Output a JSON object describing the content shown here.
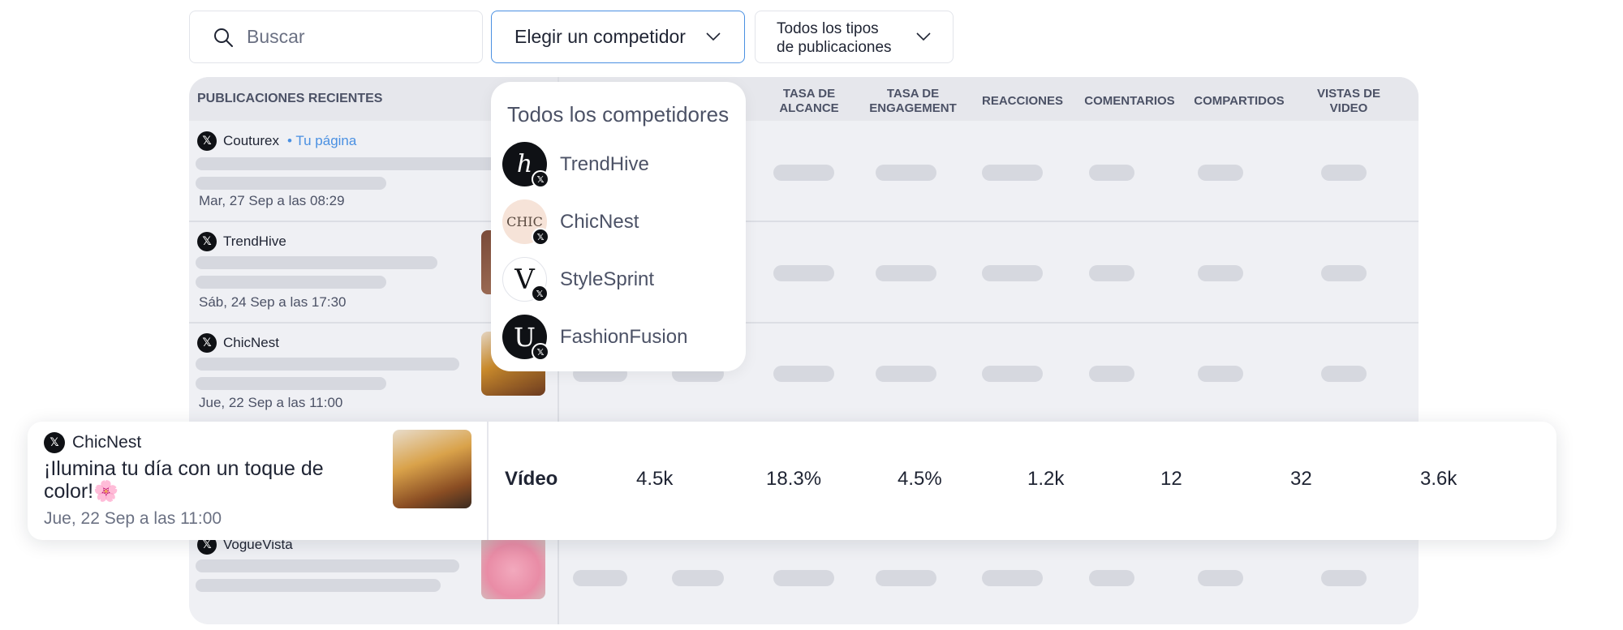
{
  "search": {
    "placeholder": "Buscar"
  },
  "competitor_dropdown": {
    "label": "Elegir un competidor"
  },
  "type_dropdown": {
    "label_line1": "Todos los tipos",
    "label_line2": "de publicaciones"
  },
  "table": {
    "headers": {
      "posts": "PUBLICACIONES RECIENTES",
      "reach_rate": [
        "TASA DE",
        "ALCANCE"
      ],
      "engagement_rate": [
        "TASA DE",
        "ENGAGEMENT"
      ],
      "reactions": "REACCIONES",
      "comments": "COMENTARIOS",
      "shares": "COMPARTIDOS",
      "video_views": [
        "VISTAS DE",
        "VIDEO"
      ]
    },
    "rows": [
      {
        "brand": "Couturex",
        "tag": "• Tu página",
        "date": "Mar, 27 Sep a las 08:29"
      },
      {
        "brand": "TrendHive",
        "date": "Sáb, 24 Sep a las 17:30"
      },
      {
        "brand": "ChicNest",
        "date": "Jue, 22 Sep a las 11:00"
      },
      {
        "brand": "VogueVista"
      }
    ]
  },
  "competitor_menu": {
    "title": "Todos los competidores",
    "options": [
      {
        "name": "TrendHive",
        "monogram": "ℎ",
        "avatar_bg": "#0f1115",
        "avatar_fg": "#ffffff"
      },
      {
        "name": "ChicNest",
        "monogram": "CHIC",
        "avatar_bg": "#f6e3d8",
        "avatar_fg": "#5a4a40"
      },
      {
        "name": "StyleSprint",
        "monogram": "V",
        "avatar_bg": "#ffffff",
        "avatar_fg": "#0f1115"
      },
      {
        "name": "FashionFusion",
        "monogram": "U",
        "avatar_bg": "#0f1115",
        "avatar_fg": "#ffffff"
      }
    ]
  },
  "featured_post": {
    "brand": "ChicNest",
    "text": "¡Ilumina tu día con un toque de color!🌸",
    "date": "Jue, 22 Sep a las 11:00",
    "type": "Vídeo",
    "values": [
      "4.5k",
      "18.3%",
      "4.5%",
      "1.2k",
      "12",
      "32",
      "3.6k"
    ]
  },
  "colors": {
    "accent": "#4a90e2",
    "table_bg": "#eff0f4",
    "skeleton": "#d6d8df",
    "platform": "#0f1115"
  },
  "icons": {
    "search": "search-icon",
    "chevron": "chevron-down-icon",
    "platform": "x-logo-icon"
  }
}
